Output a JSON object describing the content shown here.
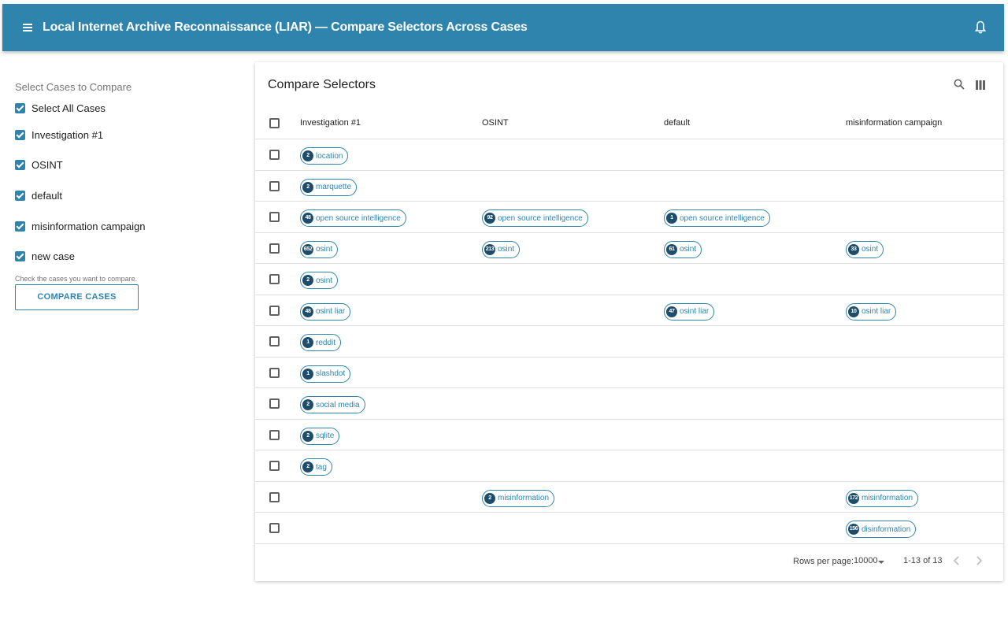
{
  "appbar": {
    "title": "Local Internet Archive Reconnaissance (LIAR) — Compare Selectors Across Cases",
    "menu_icon": "hamburger-menu-icon",
    "bell_icon": "notification-bell-icon"
  },
  "sidebar": {
    "heading": "Select Cases to Compare",
    "cases": [
      {
        "label": "Select All Cases",
        "checked": true
      },
      {
        "label": "Investigation #1",
        "checked": true
      },
      {
        "label": "OSINT",
        "checked": true
      },
      {
        "label": "default",
        "checked": true
      },
      {
        "label": "misinformation campaign",
        "checked": true
      },
      {
        "label": "new case",
        "checked": true
      }
    ],
    "helper": "Check the cases you want to compare.",
    "button_label": "COMPARE CASES"
  },
  "card": {
    "title": "Compare Selectors",
    "columns": [
      "Investigation #1",
      "OSINT",
      "default",
      "misinformation campaign"
    ],
    "rows": [
      [
        {
          "count": "2",
          "label": "location"
        },
        null,
        null,
        null
      ],
      [
        {
          "count": "2",
          "label": "marquette"
        },
        null,
        null,
        null
      ],
      [
        {
          "count": "48",
          "label": "open source intelligence"
        },
        {
          "count": "92",
          "label": "open source intelligence"
        },
        {
          "count": "1",
          "label": "open source intelligence"
        },
        null
      ],
      [
        {
          "count": "652",
          "label": "osint"
        },
        {
          "count": "213",
          "label": "osint"
        },
        {
          "count": "61",
          "label": "osint"
        },
        {
          "count": "33",
          "label": "osint"
        }
      ],
      [
        {
          "count": "2",
          "label": "osint"
        },
        null,
        null,
        null
      ],
      [
        {
          "count": "48",
          "label": "osint liar"
        },
        null,
        {
          "count": "47",
          "label": "osint liar"
        },
        {
          "count": "10",
          "label": "osint liar"
        }
      ],
      [
        {
          "count": "1",
          "label": "reddit"
        },
        null,
        null,
        null
      ],
      [
        {
          "count": "1",
          "label": "slashdot"
        },
        null,
        null,
        null
      ],
      [
        {
          "count": "2",
          "label": "social media"
        },
        null,
        null,
        null
      ],
      [
        {
          "count": "2",
          "label": "sqlite"
        },
        null,
        null,
        null
      ],
      [
        {
          "count": "2",
          "label": "tag"
        },
        null,
        null,
        null
      ],
      [
        null,
        {
          "count": "2",
          "label": "misinformation"
        },
        null,
        {
          "count": "172",
          "label": "misinformation"
        }
      ],
      [
        null,
        null,
        null,
        {
          "count": "156",
          "label": "disinformation"
        }
      ]
    ],
    "footer": {
      "rows_per_page_label": "Rows per page:",
      "rows_per_page_value": "10000",
      "range": "1-13 of 13"
    }
  },
  "colors": {
    "primary": "#2f84ad",
    "chip_count_bg": "#1e4d6b"
  }
}
